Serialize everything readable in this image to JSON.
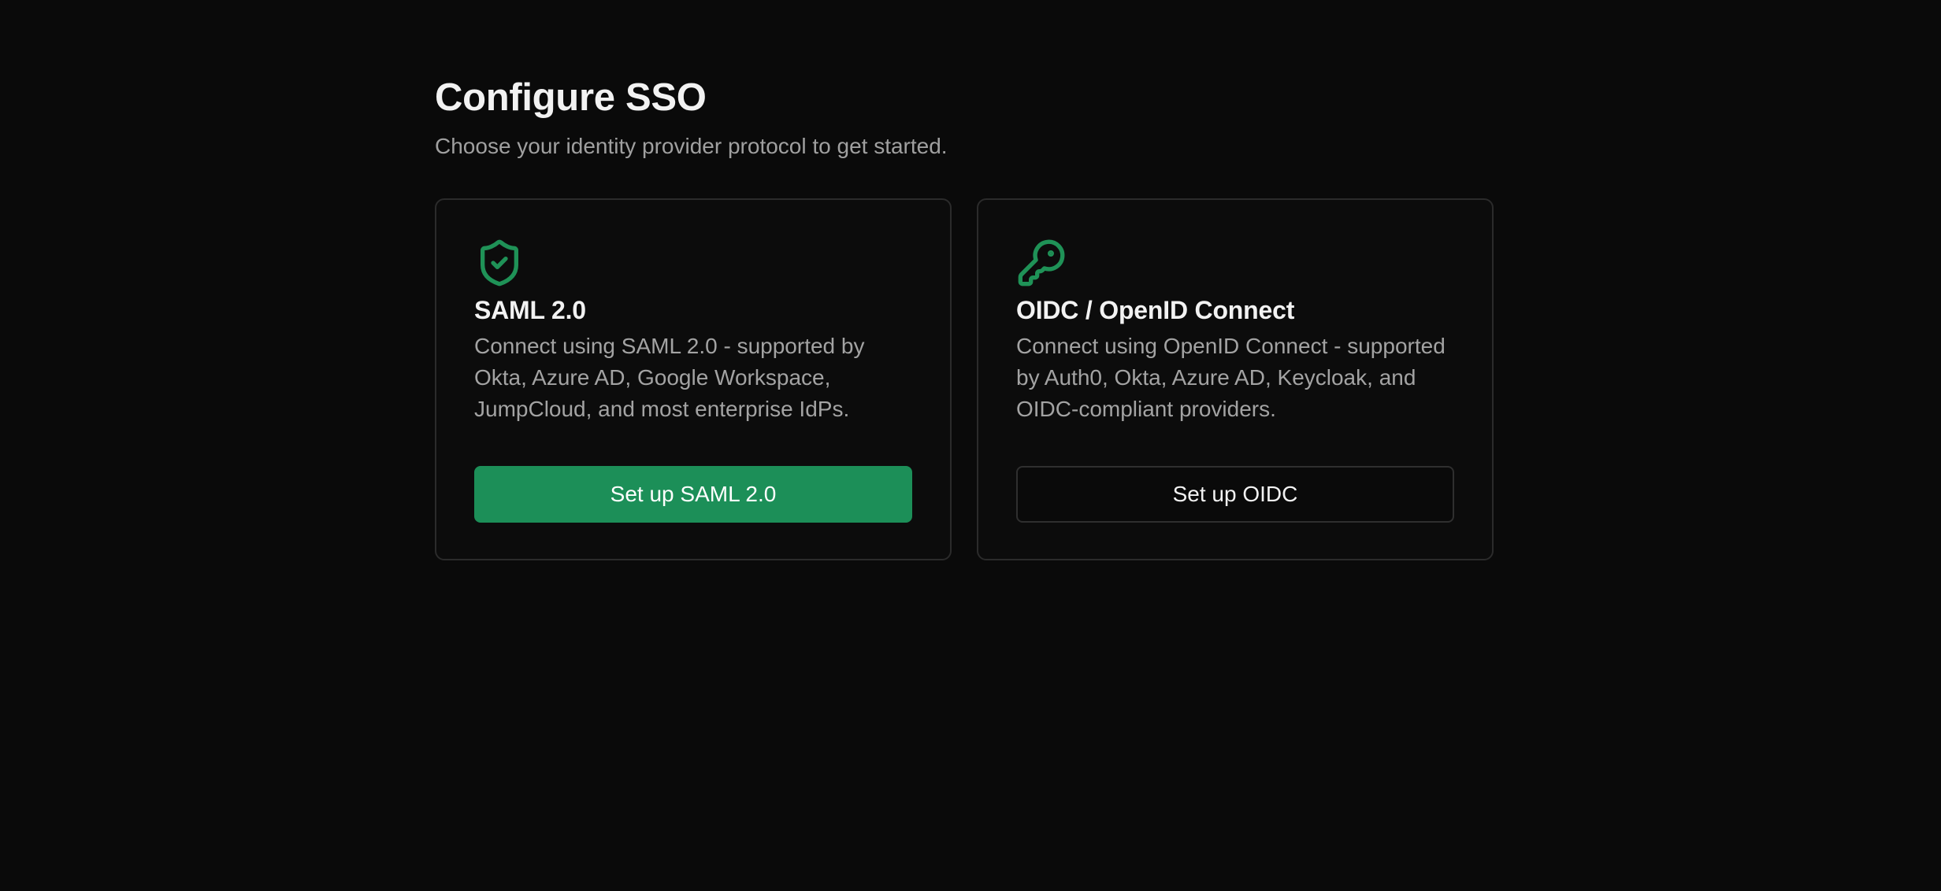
{
  "header": {
    "title": "Configure SSO",
    "subtitle": "Choose your identity provider protocol to get started."
  },
  "cards": [
    {
      "icon": "shield-check-icon",
      "title": "SAML 2.0",
      "description": "Connect using SAML 2.0 - supported by Okta, Azure AD, Google Workspace, JumpCloud, and most enterprise IdPs.",
      "button_label": "Set up SAML 2.0",
      "button_style": "primary"
    },
    {
      "icon": "key-icon",
      "title": "OIDC / OpenID Connect",
      "description": "Connect using OpenID Connect - supported by Auth0, Okta, Azure AD, Keycloak, and OIDC-compliant providers.",
      "button_label": "Set up OIDC",
      "button_style": "secondary"
    }
  ],
  "colors": {
    "background": "#0a0a0a",
    "accent": "#1c8f58",
    "icon": "#1f9257",
    "card_border": "#2b2b2b",
    "muted_text": "#a3a3a3"
  }
}
